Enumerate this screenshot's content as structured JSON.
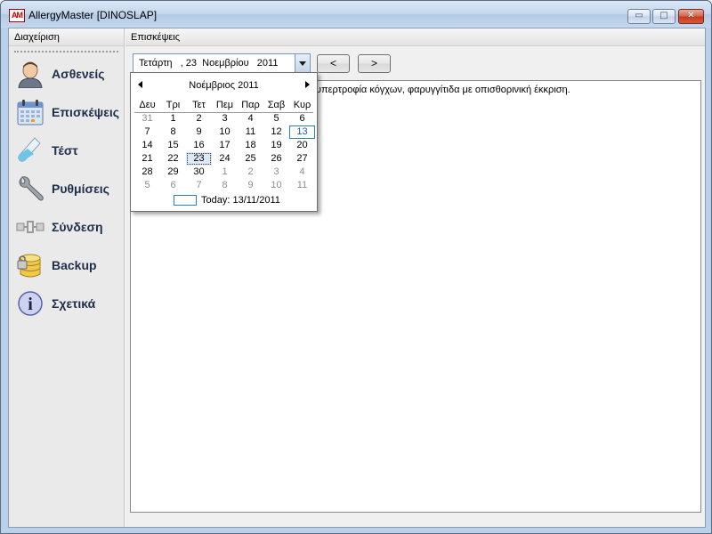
{
  "window": {
    "app_icon_text": "AM",
    "title": "AllergyMaster [DINOSLAP]",
    "minimize_symbol": "▭",
    "maximize_symbol": "□",
    "close_symbol": "✕"
  },
  "sidebar": {
    "header": "Διαχείριση",
    "items": [
      {
        "label": "Ασθενείς",
        "icon": "patient-icon"
      },
      {
        "label": "Επισκέψεις",
        "icon": "calendar-icon"
      },
      {
        "label": "Τέστ",
        "icon": "test-tube-icon"
      },
      {
        "label": "Ρυθμίσεις",
        "icon": "wrench-icon"
      },
      {
        "label": "Σύνδεση",
        "icon": "connection-icon"
      },
      {
        "label": "Backup",
        "icon": "database-icon"
      },
      {
        "label": "Σχετικά",
        "icon": "info-icon"
      }
    ]
  },
  "main": {
    "header": "Επισκέψεις",
    "date_value": "Τετάρτη   , 23  Νοεμβρίου   2011",
    "prev_label": "<",
    "next_label": ">",
    "visit_text": "υπερτροφία κόγχων, φαρυγγίτιδα με οπισθορινική έκκριση."
  },
  "calendar": {
    "month_label": "Νοέμβριος 2011",
    "weekdays": [
      "Δευ",
      "Τρι",
      "Τετ",
      "Πεμ",
      "Παρ",
      "Σαβ",
      "Κυρ"
    ],
    "weeks": [
      [
        {
          "d": "31",
          "o": true
        },
        {
          "d": "1"
        },
        {
          "d": "2"
        },
        {
          "d": "3"
        },
        {
          "d": "4"
        },
        {
          "d": "5"
        },
        {
          "d": "6"
        }
      ],
      [
        {
          "d": "7"
        },
        {
          "d": "8"
        },
        {
          "d": "9"
        },
        {
          "d": "10"
        },
        {
          "d": "11"
        },
        {
          "d": "12"
        },
        {
          "d": "13",
          "today": true
        }
      ],
      [
        {
          "d": "14"
        },
        {
          "d": "15"
        },
        {
          "d": "16"
        },
        {
          "d": "17"
        },
        {
          "d": "18"
        },
        {
          "d": "19"
        },
        {
          "d": "20"
        }
      ],
      [
        {
          "d": "21"
        },
        {
          "d": "22"
        },
        {
          "d": "23",
          "sel": true
        },
        {
          "d": "24"
        },
        {
          "d": "25"
        },
        {
          "d": "26"
        },
        {
          "d": "27"
        }
      ],
      [
        {
          "d": "28"
        },
        {
          "d": "29"
        },
        {
          "d": "30"
        },
        {
          "d": "1",
          "o": true
        },
        {
          "d": "2",
          "o": true
        },
        {
          "d": "3",
          "o": true
        },
        {
          "d": "4",
          "o": true
        }
      ],
      [
        {
          "d": "5",
          "o": true
        },
        {
          "d": "6",
          "o": true
        },
        {
          "d": "7",
          "o": true
        },
        {
          "d": "8",
          "o": true
        },
        {
          "d": "9",
          "o": true
        },
        {
          "d": "10",
          "o": true
        },
        {
          "d": "11",
          "o": true
        }
      ]
    ],
    "today_label": "Today: 13/11/2011"
  }
}
